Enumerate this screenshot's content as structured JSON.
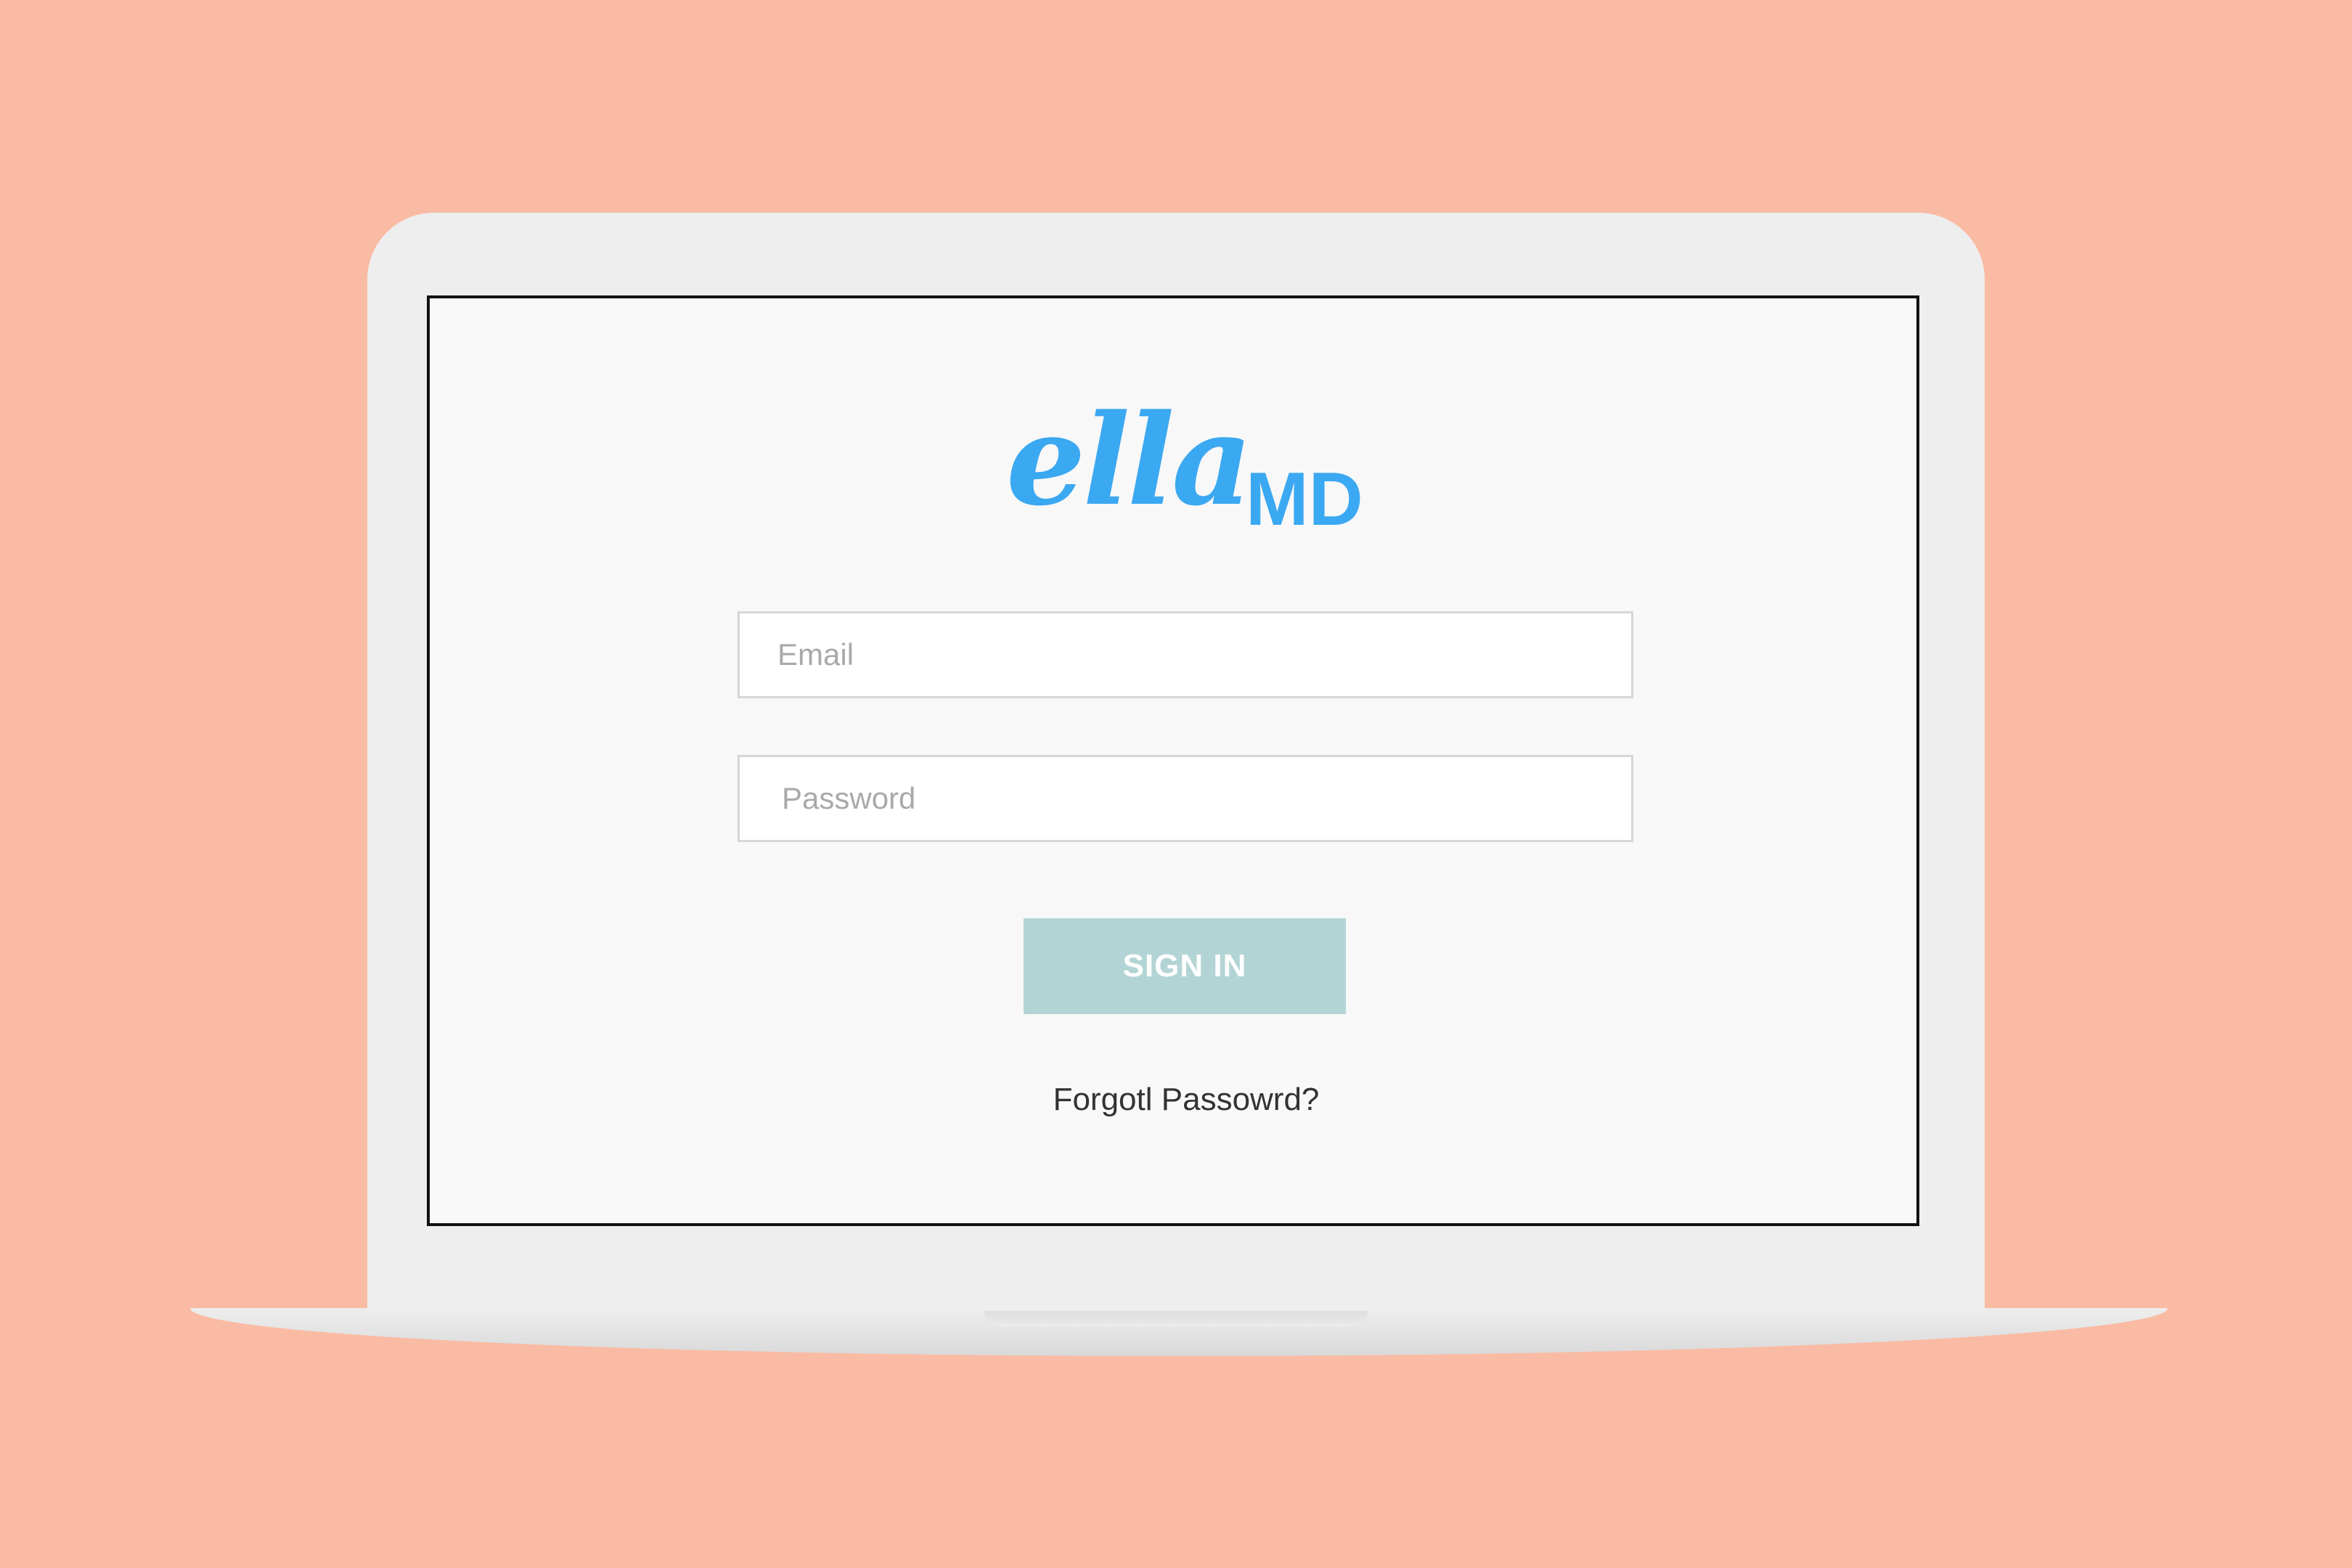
{
  "brand": {
    "logo_script": "ella",
    "logo_suffix": "MD",
    "color": "#3ba8f2"
  },
  "login_form": {
    "email_placeholder": "Email",
    "password_placeholder": "Password",
    "signin_label": "SIGN IN",
    "forgot_label": "Forgotl Passowrd?"
  },
  "colors": {
    "background": "#fabba4",
    "button": "#b3d4d5"
  }
}
